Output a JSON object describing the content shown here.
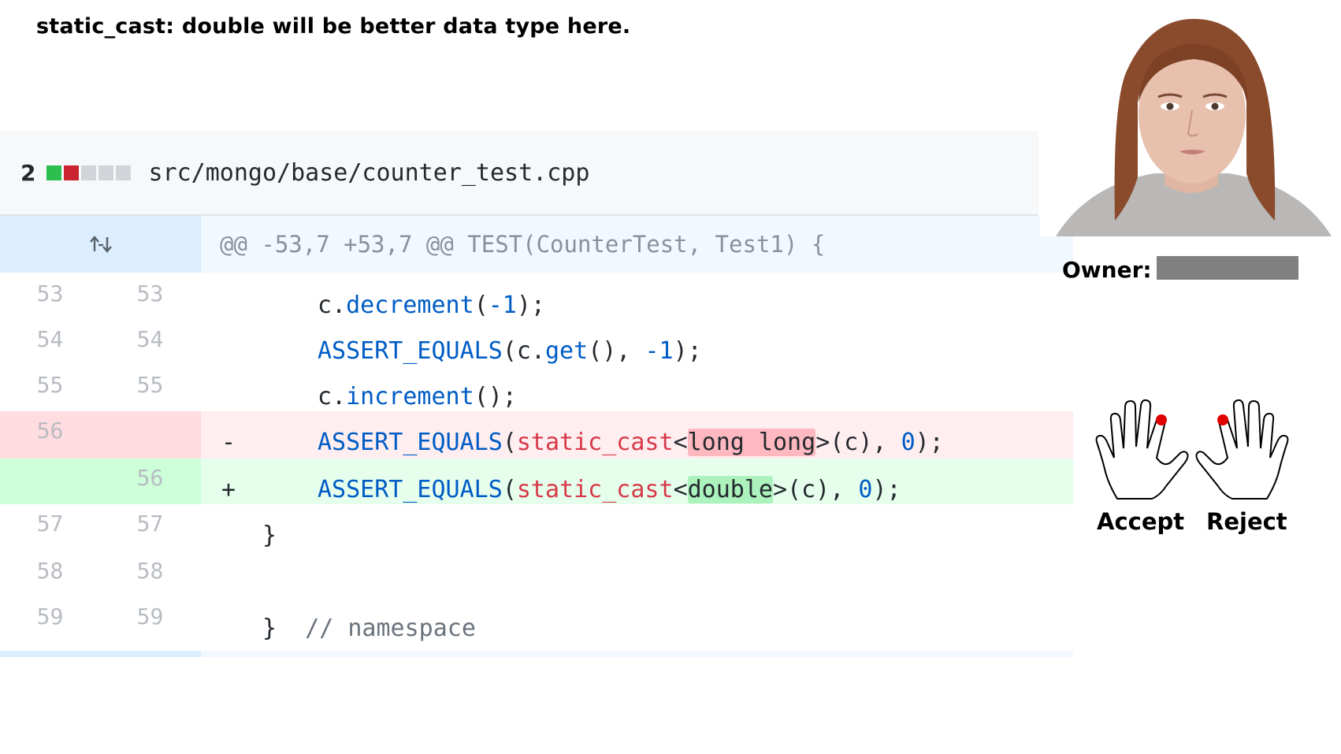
{
  "question": "static_cast: double will be better data type here.",
  "file": {
    "changes": "2",
    "path": "src/mongo/base/counter_test.cpp",
    "diffstat_colors": [
      "#2cbe4e",
      "#cb2431",
      "#d1d5da",
      "#d1d5da",
      "#d1d5da"
    ]
  },
  "hunk": {
    "header": "@@ -53,7 +53,7 @@ TEST(CounterTest, Test1) {",
    "expand_icon": "unfold-icon"
  },
  "lines": {
    "l53": {
      "old": "53",
      "new": "53"
    },
    "l54": {
      "old": "54",
      "new": "54"
    },
    "l55": {
      "old": "55",
      "new": "55"
    },
    "l56del": {
      "old": "56",
      "marker": "-"
    },
    "l56add": {
      "new": "56",
      "marker": "+"
    },
    "l57": {
      "old": "57",
      "new": "57"
    },
    "l58": {
      "old": "58",
      "new": "58"
    },
    "l59": {
      "old": "59",
      "new": "59"
    }
  },
  "tokens": {
    "c": "c",
    "dot": ".",
    "decrement": "decrement",
    "increment": "increment",
    "get": "get",
    "assert": "ASSERT_EQUALS",
    "static_cast": "static_cast",
    "long_long": "long long",
    "double": "double",
    "neg1": "-1",
    "zero": "0",
    "brace": "}",
    "comment": "// namespace"
  },
  "reviewer": {
    "owner_label": "Owner:",
    "photo_icon": "person-portrait"
  },
  "actions": {
    "accept_label": "Accept",
    "reject_label": "Reject",
    "hand_icon": "hand-outline-icon",
    "dot_color": "#e00000"
  }
}
